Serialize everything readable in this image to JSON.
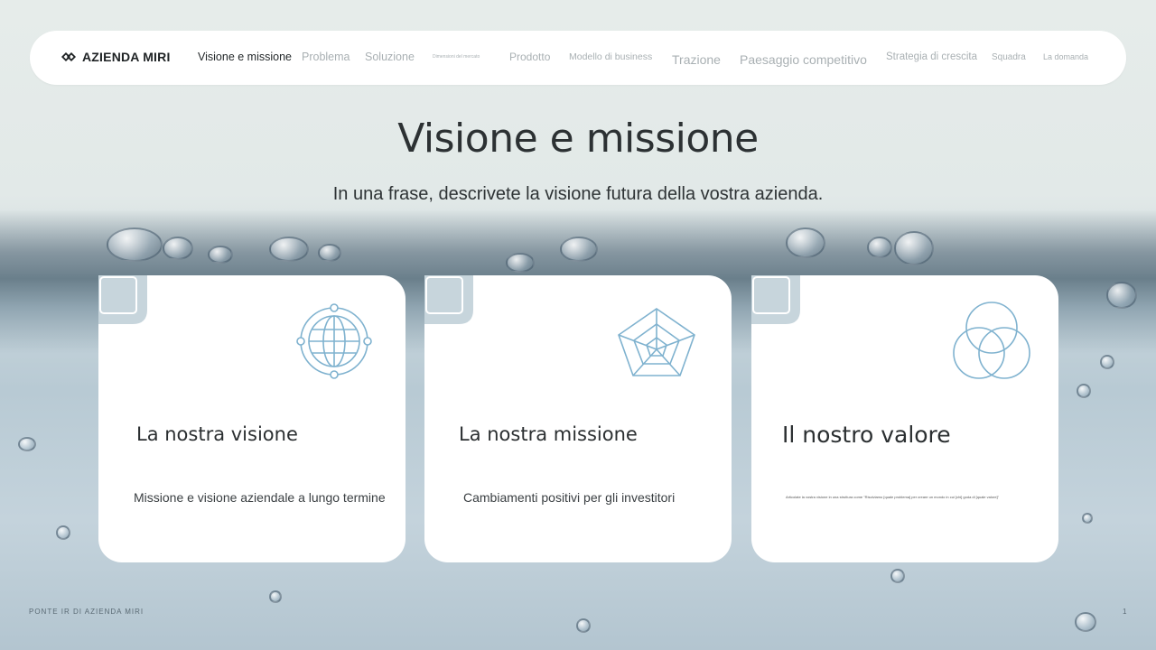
{
  "brand": {
    "name": "AZIENDA MIRI"
  },
  "nav": {
    "items": [
      {
        "label": "Visione e missione",
        "active": true
      },
      {
        "label": "Problema"
      },
      {
        "label": "Soluzione"
      },
      {
        "label": "Dimensioni del mercato"
      },
      {
        "label": "Prodotto"
      },
      {
        "label": "Modello di business"
      },
      {
        "label": "Trazione"
      },
      {
        "label": "Paesaggio competitivo"
      },
      {
        "label": "Strategia di crescita"
      },
      {
        "label": "Squadra"
      },
      {
        "label": "La domanda"
      }
    ]
  },
  "main": {
    "title": "Visione e missione",
    "subtitle": "In una frase, descrivete la visione futura della vostra azienda."
  },
  "cards": [
    {
      "icon": "globe-icon",
      "heading": "La nostra visione",
      "text": "Missione e visione aziendale a lungo termine"
    },
    {
      "icon": "radar-pentagon-icon",
      "heading": "La nostra missione",
      "text": "Cambiamenti positivi per gli investitori"
    },
    {
      "icon": "venn-circles-icon",
      "heading": "Il nostro valore",
      "text": "Articolate la vostra visione in una struttura come \"Risolviamo [quale problema] per creare un mondo in cui [chi] goda di [quale valore]\""
    }
  ],
  "footer": {
    "left": "PONTE IR DI AZIENDA MIRI",
    "page": "1"
  },
  "colors": {
    "icon_stroke": "#7fb2cf",
    "accent_text": "#2b2f31",
    "nav_muted": "#a9b0b3"
  }
}
